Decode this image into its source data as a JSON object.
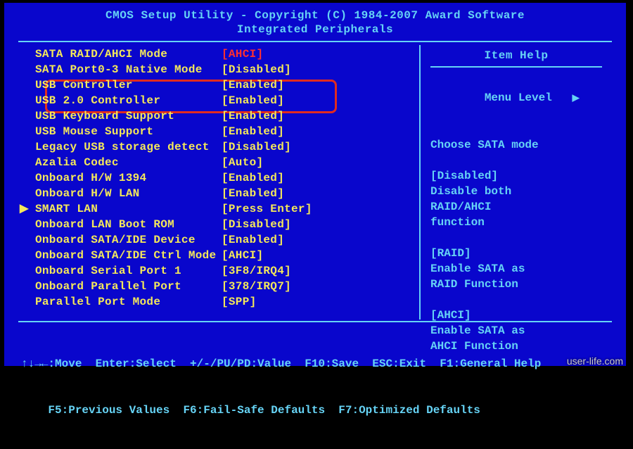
{
  "header": {
    "line1": "CMOS Setup Utility - Copyright (C) 1984-2007 Award Software",
    "line2": "Integrated Peripherals"
  },
  "settings": [
    {
      "label": "SATA RAID/AHCI Mode",
      "value": "[AHCI]",
      "valueClass": "ahci-red"
    },
    {
      "label": "SATA Port0-3 Native Mode",
      "value": "[Disabled]"
    },
    {
      "label": "USB Controller",
      "value": "[Enabled]"
    },
    {
      "label": "USB 2.0 Controller",
      "value": "[Enabled]"
    },
    {
      "label": "USB Keyboard Support",
      "value": "[Enabled]"
    },
    {
      "label": "USB Mouse Support",
      "value": "[Enabled]"
    },
    {
      "label": "Legacy USB storage detect",
      "value": "[Disabled]"
    },
    {
      "label": "Azalia Codec",
      "value": "[Auto]"
    },
    {
      "label": "Onboard H/W 1394",
      "value": "[Enabled]"
    },
    {
      "label": "Onboard H/W LAN",
      "value": "[Enabled]"
    },
    {
      "label": "SMART LAN",
      "value": "[Press Enter]",
      "arrow": true
    },
    {
      "label": "Onboard LAN Boot ROM",
      "value": "[Disabled]"
    },
    {
      "label": "Onboard SATA/IDE Device",
      "value": "[Enabled]"
    },
    {
      "label": "Onboard SATA/IDE Ctrl Mode",
      "value": "[AHCI]"
    },
    {
      "label": "Onboard Serial Port 1",
      "value": "[3F8/IRQ4]"
    },
    {
      "label": "Onboard Parallel Port",
      "value": "[378/IRQ7]"
    },
    {
      "label": "Parallel Port Mode",
      "value": "[SPP]"
    }
  ],
  "help": {
    "title": "Item Help",
    "menuLevel": "Menu Level   ",
    "lines": [
      "",
      "Choose SATA mode",
      "",
      "[Disabled]",
      "Disable both",
      "RAID/AHCI",
      "function",
      "",
      "[RAID]",
      "Enable SATA as",
      "RAID Function",
      "",
      "[AHCI]",
      "Enable SATA as",
      "AHCI Function"
    ]
  },
  "footer": {
    "line1": "↑↓→←:Move  Enter:Select  +/-/PU/PD:Value  F10:Save  ESC:Exit  F1:General Help",
    "line2": "    F5:Previous Values  F6:Fail-Safe Defaults  F7:Optimized Defaults"
  },
  "watermark": "user-life.com"
}
